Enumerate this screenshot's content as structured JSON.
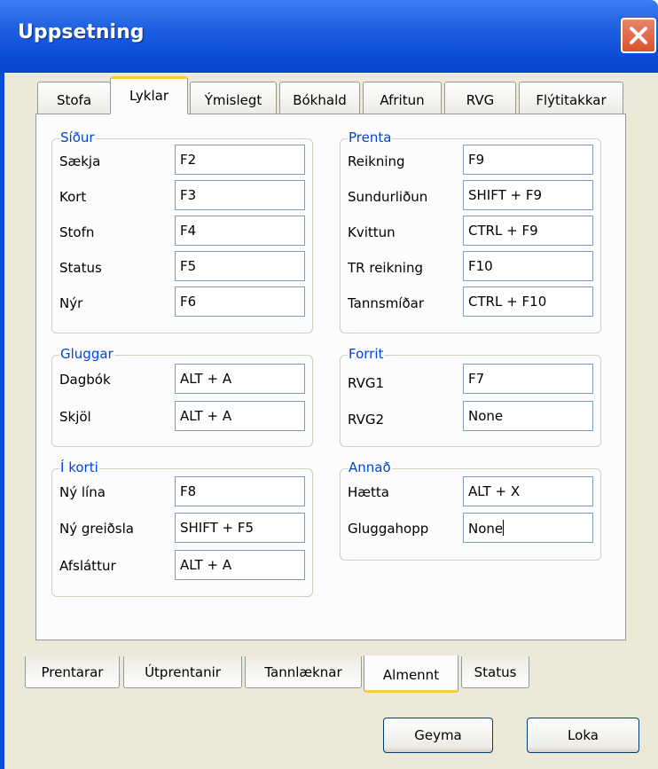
{
  "window": {
    "title": "Uppsetning"
  },
  "top_tabs": [
    "Stofa",
    "Lyklar",
    "Ýmislegt",
    "Bókhald",
    "Afritun",
    "RVG",
    "Flýtitakkar"
  ],
  "groups": {
    "sidur": {
      "legend": "Síður",
      "rows": [
        {
          "label": "Sækja",
          "value": "F2"
        },
        {
          "label": "Kort",
          "value": "F3"
        },
        {
          "label": "Stofn",
          "value": "F4"
        },
        {
          "label": "Status",
          "value": "F5"
        },
        {
          "label": "Nýr",
          "value": "F6"
        }
      ]
    },
    "prenta": {
      "legend": "Prenta",
      "rows": [
        {
          "label": "Reikning",
          "value": "F9"
        },
        {
          "label": "Sundurliðun",
          "value": "SHIFT + F9"
        },
        {
          "label": "Kvittun",
          "value": "CTRL + F9"
        },
        {
          "label": "TR reikning",
          "value": "F10"
        },
        {
          "label": "Tannsmíðar",
          "value": "CTRL + F10"
        }
      ]
    },
    "gluggar": {
      "legend": "Gluggar",
      "rows": [
        {
          "label": "Dagbók",
          "value": "ALT + A"
        },
        {
          "label": "Skjöl",
          "value": "ALT + A"
        }
      ]
    },
    "forrit": {
      "legend": "Forrit",
      "rows": [
        {
          "label": "RVG1",
          "value": "F7"
        },
        {
          "label": "RVG2",
          "value": "None"
        }
      ]
    },
    "ikorti": {
      "legend": "Í korti",
      "rows": [
        {
          "label": "Ný lína",
          "value": "F8"
        },
        {
          "label": "Ný greiðsla",
          "value": "SHIFT + F5"
        },
        {
          "label": "Afsláttur",
          "value": "ALT + A"
        }
      ]
    },
    "annad": {
      "legend": "Annað",
      "rows": [
        {
          "label": "Hætta",
          "value": "ALT + X"
        },
        {
          "label": "Gluggahopp",
          "value": "None"
        }
      ]
    }
  },
  "bottom_tabs": [
    "Prentarar",
    "Útprentanir",
    "Tannlæknar",
    "Almennt",
    "Status"
  ],
  "buttons": {
    "save": "Geyma",
    "close": "Loka"
  }
}
